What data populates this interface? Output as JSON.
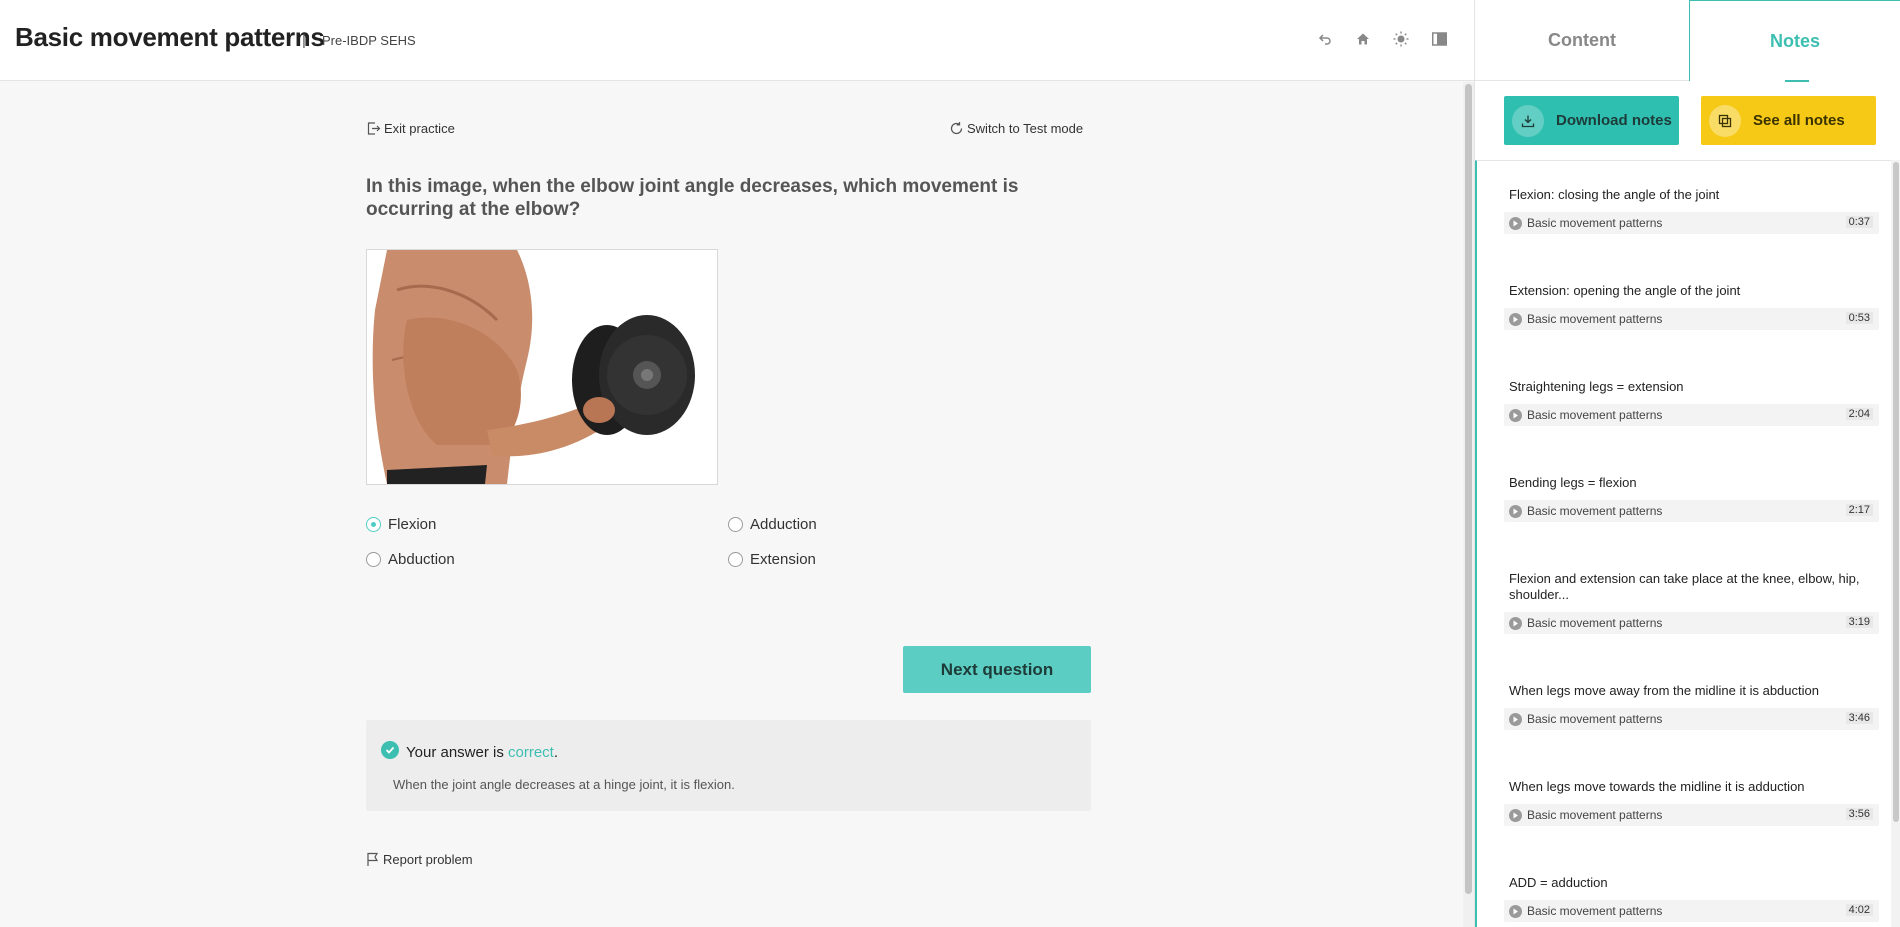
{
  "header": {
    "title": "Basic movement patterns",
    "separator": "|",
    "subject": "Pre-IBDP SEHS",
    "icons": [
      "undo-icon",
      "home-icon",
      "brightness-icon",
      "sidebar-toggle-icon"
    ]
  },
  "practice": {
    "exit_label": "Exit practice",
    "switch_label": "Switch to Test mode",
    "question": "In this image, when the elbow joint angle decreases, which movement is occurring at the elbow?",
    "image_alt": "Muscular arm lifting a dumbbell with elbow bent",
    "options": [
      {
        "label": "Flexion",
        "selected": true
      },
      {
        "label": "Adduction",
        "selected": false
      },
      {
        "label": "Abduction",
        "selected": false
      },
      {
        "label": "Extension",
        "selected": false
      }
    ],
    "next_label": "Next question",
    "feedback": {
      "prefix": "Your answer is ",
      "status": "correct",
      "suffix": ".",
      "explanation": "When the joint angle decreases at a hinge joint, it is flexion."
    },
    "report_label": "Report problem"
  },
  "side": {
    "tabs": [
      {
        "label": "Content",
        "active": false
      },
      {
        "label": "Notes",
        "active": true
      }
    ],
    "download_label": "Download notes",
    "see_all_label": "See all notes",
    "notes": [
      {
        "text": "Flexion: closing the angle of the joint",
        "ref": "Basic movement patterns",
        "time": "0:37"
      },
      {
        "text": "Extension: opening the angle of the joint",
        "ref": "Basic movement patterns",
        "time": "0:53"
      },
      {
        "text": "Straightening legs = extension",
        "ref": "Basic movement patterns",
        "time": "2:04"
      },
      {
        "text": "Bending legs = flexion",
        "ref": "Basic movement patterns",
        "time": "2:17"
      },
      {
        "text": "Flexion and extension can take place at the knee, elbow, hip, shoulder...",
        "ref": "Basic movement patterns",
        "time": "3:19"
      },
      {
        "text": "When legs move away from the midline it is abduction",
        "ref": "Basic movement patterns",
        "time": "3:46"
      },
      {
        "text": "When legs move towards the midline it is adduction",
        "ref": "Basic movement patterns",
        "time": "3:56"
      },
      {
        "text": "ADD = adduction",
        "ref": "Basic movement patterns",
        "time": "4:02"
      }
    ]
  },
  "colors": {
    "accent": "#3cbfb1",
    "button_teal": "#5ccdc2",
    "button_yellow": "#f5c915"
  }
}
